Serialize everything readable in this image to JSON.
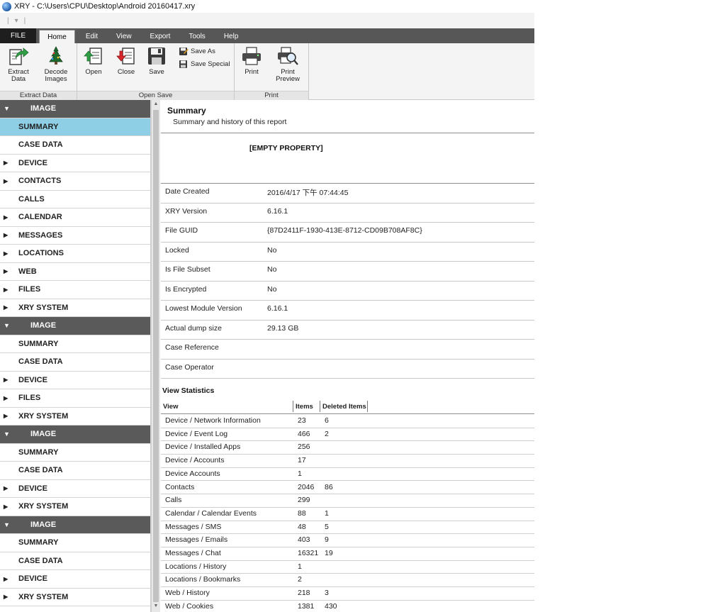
{
  "window": {
    "title": "XRY - C:\\Users\\CPU\\Desktop\\Android 20160417.xry"
  },
  "quick_access": [
    "|",
    "▾",
    "|"
  ],
  "ribbon_tabs": [
    {
      "label": "FILE"
    },
    {
      "label": "Home"
    },
    {
      "label": "Edit"
    },
    {
      "label": "View"
    },
    {
      "label": "Export"
    },
    {
      "label": "Tools"
    },
    {
      "label": "Help"
    }
  ],
  "active_tab": "Home",
  "ribbon": {
    "extract_group_label": "Extract Data",
    "extract_data_line1": "Extract",
    "extract_data_line2": "Data",
    "decode_images_line1": "Decode",
    "decode_images_line2": "Images",
    "open_save_group_label": "Open Save",
    "open_label": "Open",
    "close_label": "Close",
    "save_label": "Save",
    "save_as_label": "Save As",
    "save_special_label": "Save Special",
    "print_group_label": "Print",
    "print_label": "Print",
    "print_preview_line1": "Print",
    "print_preview_line2": "Preview"
  },
  "tree": [
    {
      "label": "IMAGE",
      "type": "image",
      "arrow": "▼"
    },
    {
      "label": "SUMMARY",
      "type": "selected",
      "arrow": ""
    },
    {
      "label": "CASE DATA",
      "type": "leaf",
      "arrow": ""
    },
    {
      "label": "DEVICE",
      "type": "branch",
      "arrow": "▶"
    },
    {
      "label": "CONTACTS",
      "type": "branch",
      "arrow": "▶"
    },
    {
      "label": "CALLS",
      "type": "leaf",
      "arrow": ""
    },
    {
      "label": "CALENDAR",
      "type": "branch",
      "arrow": "▶"
    },
    {
      "label": "MESSAGES",
      "type": "branch",
      "arrow": "▶"
    },
    {
      "label": "LOCATIONS",
      "type": "branch",
      "arrow": "▶"
    },
    {
      "label": "WEB",
      "type": "branch",
      "arrow": "▶"
    },
    {
      "label": "FILES",
      "type": "branch",
      "arrow": "▶"
    },
    {
      "label": "XRY SYSTEM",
      "type": "branch",
      "arrow": "▶"
    },
    {
      "label": "IMAGE",
      "type": "image",
      "arrow": "▼"
    },
    {
      "label": "SUMMARY",
      "type": "leaf",
      "arrow": ""
    },
    {
      "label": "CASE DATA",
      "type": "leaf",
      "arrow": ""
    },
    {
      "label": "DEVICE",
      "type": "branch",
      "arrow": "▶"
    },
    {
      "label": "FILES",
      "type": "branch",
      "arrow": "▶"
    },
    {
      "label": "XRY SYSTEM",
      "type": "branch",
      "arrow": "▶"
    },
    {
      "label": "IMAGE",
      "type": "image",
      "arrow": "▼"
    },
    {
      "label": "SUMMARY",
      "type": "leaf",
      "arrow": ""
    },
    {
      "label": "CASE DATA",
      "type": "leaf",
      "arrow": ""
    },
    {
      "label": "DEVICE",
      "type": "branch",
      "arrow": "▶"
    },
    {
      "label": "XRY SYSTEM",
      "type": "branch",
      "arrow": "▶"
    },
    {
      "label": "IMAGE",
      "type": "image",
      "arrow": "▼"
    },
    {
      "label": "SUMMARY",
      "type": "leaf",
      "arrow": ""
    },
    {
      "label": "CASE DATA",
      "type": "leaf",
      "arrow": ""
    },
    {
      "label": "DEVICE",
      "type": "branch",
      "arrow": "▶"
    },
    {
      "label": "XRY SYSTEM",
      "type": "branch",
      "arrow": "▶"
    }
  ],
  "scrollbar": {
    "up": "▲",
    "down": "▼"
  },
  "report": {
    "title": "Summary",
    "subtitle": "Summary and history of this report",
    "empty_property": "[EMPTY PROPERTY]",
    "properties": [
      {
        "key": "Date Created",
        "value": "2016/4/17 下午 07:44:45"
      },
      {
        "key": "XRY Version",
        "value": "6.16.1"
      },
      {
        "key": "File GUID",
        "value": "{87D2411F-1930-413E-8712-CD09B708AF8C}"
      },
      {
        "key": "Locked",
        "value": "No"
      },
      {
        "key": "Is File Subset",
        "value": "No"
      },
      {
        "key": "Is Encrypted",
        "value": "No"
      },
      {
        "key": "Lowest Module Version",
        "value": "6.16.1"
      },
      {
        "key": "Actual dump size",
        "value": "29.13 GB"
      },
      {
        "key": "Case Reference",
        "value": ""
      },
      {
        "key": "Case Operator",
        "value": ""
      }
    ],
    "view_statistics_title": "View Statistics",
    "columns": [
      "View",
      "Items",
      "Deleted Items"
    ],
    "statistics": [
      {
        "view": "Device / Network Information",
        "items": "23",
        "deleted": "6"
      },
      {
        "view": "Device / Event Log",
        "items": "466",
        "deleted": "2"
      },
      {
        "view": "Device / Installed Apps",
        "items": "256",
        "deleted": ""
      },
      {
        "view": "Device / Accounts",
        "items": "17",
        "deleted": ""
      },
      {
        "view": "Device Accounts",
        "items": "1",
        "deleted": ""
      },
      {
        "view": "Contacts",
        "items": "2046",
        "deleted": "86"
      },
      {
        "view": "Calls",
        "items": "299",
        "deleted": ""
      },
      {
        "view": "Calendar / Calendar Events",
        "items": "88",
        "deleted": "1"
      },
      {
        "view": "Messages / SMS",
        "items": "48",
        "deleted": "5"
      },
      {
        "view": "Messages / Emails",
        "items": "403",
        "deleted": "9"
      },
      {
        "view": "Messages / Chat",
        "items": "16321",
        "deleted": "19"
      },
      {
        "view": "Locations / History",
        "items": "1",
        "deleted": ""
      },
      {
        "view": "Locations / Bookmarks",
        "items": "2",
        "deleted": ""
      },
      {
        "view": "Web / History",
        "items": "218",
        "deleted": "3"
      },
      {
        "view": "Web / Cookies",
        "items": "1381",
        "deleted": "430"
      }
    ]
  }
}
